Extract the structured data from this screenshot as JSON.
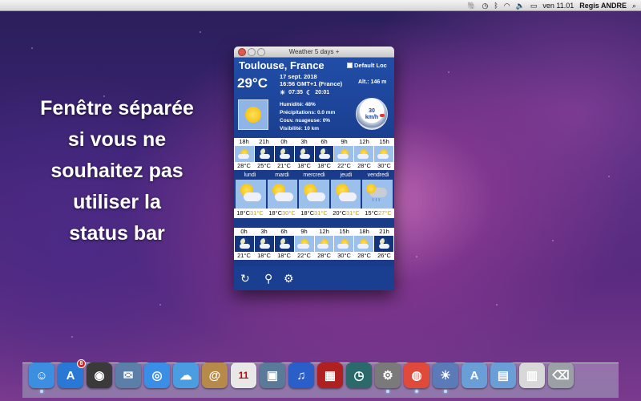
{
  "menubar": {
    "apple_icon": "apple-icon",
    "clock": "ven 11.01",
    "user": "Regis ANDRE",
    "status_icons": [
      "evernote-icon",
      "time-machine-icon",
      "bluetooth-icon",
      "wifi-icon",
      "volume-icon",
      "battery-icon"
    ],
    "battery_glyph": "▭",
    "search_glyph": "⌕"
  },
  "caption": {
    "line1": "Fenêtre séparée",
    "line2": "si vous ne",
    "line3": "souhaitez pas",
    "line4": "utiliser la",
    "line5": "status bar"
  },
  "window": {
    "title": "Weather 5 days +",
    "current": {
      "city": "Toulouse, France",
      "default_loc_label": "Default Loc",
      "temperature": "29°C",
      "date": "17 sept. 2018",
      "time": "16:56 GMT+1 (France)",
      "sunrise": "07:35",
      "sunset": "20:01",
      "altitude": "Alt.: 146 m",
      "humidity": "Humidité: 48%",
      "precipitation": "Précipitations: 0.0 mm",
      "cloud_cover": "Couv. nuageuse: 0%",
      "visibility": "Visibilité: 10 km",
      "wind_value": "30",
      "wind_unit": "km/h",
      "icon": "sunny-icon"
    },
    "hourly_1": {
      "hours": [
        "18h",
        "21h",
        "0h",
        "3h",
        "6h",
        "9h",
        "12h",
        "15h"
      ],
      "temps": [
        "28°C",
        "25°C",
        "21°C",
        "18°C",
        "18°C",
        "22°C",
        "28°C",
        "30°C"
      ],
      "icons": [
        "day",
        "night",
        "night",
        "night",
        "night",
        "day",
        "day",
        "day"
      ]
    },
    "daily": {
      "days": [
        "lundi",
        "mardi",
        "mercredi",
        "jeudi",
        "vendredi"
      ],
      "lows": [
        "18°C",
        "18°C",
        "18°C",
        "20°C",
        "15°C"
      ],
      "highs": [
        "31°C",
        "30°C",
        "31°C",
        "31°C",
        "27°C"
      ],
      "icons": [
        "partly-sunny-icon",
        "partly-sunny-icon",
        "partly-sunny-icon",
        "partly-sunny-icon",
        "rain-icon"
      ]
    },
    "hourly_2": {
      "hours": [
        "0h",
        "3h",
        "6h",
        "9h",
        "12h",
        "15h",
        "18h",
        "21h"
      ],
      "temps": [
        "21°C",
        "18°C",
        "18°C",
        "22°C",
        "28°C",
        "30°C",
        "28°C",
        "26°C"
      ],
      "icons": [
        "night",
        "night",
        "night",
        "day",
        "day",
        "day",
        "day",
        "night"
      ]
    },
    "toolbar": {
      "refresh_glyph": "↻",
      "search_glyph": "⚲",
      "settings_glyph": "⚙"
    }
  },
  "dock": {
    "apps": [
      {
        "name": "finder",
        "glyph": "☺",
        "color": "#3c8fe0",
        "running": true
      },
      {
        "name": "app-store",
        "glyph": "A",
        "color": "#2a78d6",
        "badge": "8",
        "running": false
      },
      {
        "name": "dashboard",
        "glyph": "◉",
        "color": "#3a3a3a",
        "running": false
      },
      {
        "name": "mail",
        "glyph": "✉",
        "color": "#5b7fa8",
        "running": false
      },
      {
        "name": "safari",
        "glyph": "◎",
        "color": "#3a8ee6",
        "running": false
      },
      {
        "name": "ichat",
        "glyph": "☁",
        "color": "#4a9de0",
        "running": false
      },
      {
        "name": "address-book",
        "glyph": "@",
        "color": "#b88a4a",
        "running": false
      },
      {
        "name": "ical",
        "glyph": "11",
        "color": "#e8e8e8",
        "running": false
      },
      {
        "name": "iphoto",
        "glyph": "▣",
        "color": "#5a7a9a",
        "running": false
      },
      {
        "name": "itunes",
        "glyph": "♫",
        "color": "#2a5ec8",
        "running": false
      },
      {
        "name": "photo-booth",
        "glyph": "▦",
        "color": "#b02020",
        "running": false
      },
      {
        "name": "time-machine",
        "glyph": "◷",
        "color": "#2a6a6a",
        "running": false
      },
      {
        "name": "system-preferences",
        "glyph": "⚙",
        "color": "#7a7a7a",
        "running": true
      },
      {
        "name": "chrome",
        "glyph": "◍",
        "color": "#e04a3a",
        "running": true
      },
      {
        "name": "weather",
        "glyph": "☀",
        "color": "#5a7ab8",
        "running": true
      },
      {
        "name": "applications-folder",
        "glyph": "A",
        "color": "#6a9ed6",
        "running": false
      },
      {
        "name": "documents-folder",
        "glyph": "▤",
        "color": "#6a9ed6",
        "running": false
      },
      {
        "name": "downloads-stack",
        "glyph": "▥",
        "color": "#d8d8d8",
        "running": false
      },
      {
        "name": "trash",
        "glyph": "⌫",
        "color": "#9aa0a6",
        "running": false
      }
    ]
  }
}
